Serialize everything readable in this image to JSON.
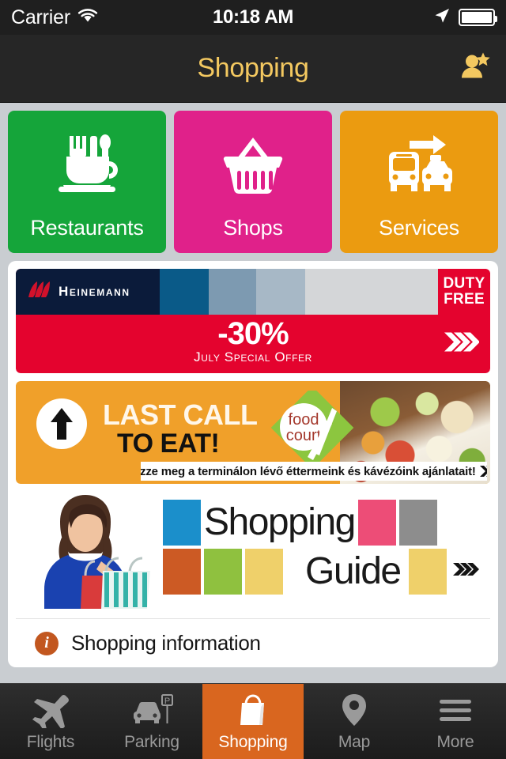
{
  "status_bar": {
    "carrier": "Carrier",
    "time": "10:18 AM",
    "wifi_icon": "wifi-icon",
    "location_icon": "location-arrow-icon",
    "battery_icon": "battery-full-icon"
  },
  "nav_bar": {
    "title": "Shopping",
    "title_color": "#f3c860",
    "right_icon": "person-star-icon"
  },
  "categories": [
    {
      "label": "Restaurants",
      "color": "#15a53a",
      "icon": "cup-cutlery-icon"
    },
    {
      "label": "Shops",
      "color": "#e0218a",
      "icon": "shopping-basket-icon"
    },
    {
      "label": "Services",
      "color": "#eb9b10",
      "icon": "bus-taxi-arrow-icon"
    }
  ],
  "promos": {
    "heinemann": {
      "brand": "Heinemann",
      "duty_free_line1": "DUTY",
      "duty_free_line2": "FREE",
      "discount": "-30%",
      "subtitle": "July Special Offer",
      "red": "#e4032e",
      "navy": "#0b1b3a",
      "chevron_icon": "chevron-triple-right-icon"
    },
    "food_court": {
      "headline_line1": "LAST CALL",
      "headline_line2": "TO EAT!",
      "logo_line1": "food",
      "logo_line2": "court",
      "caption": "Nézze meg a terminálon lévő éttermeink és  kávézóink ajánlatait!",
      "background": "#f0a02a",
      "arrow_icon": "arrow-up-circle-icon",
      "chevron_icon": "chevron-triple-right-icon"
    },
    "shopping_guide": {
      "word1": "Shopping",
      "word2": "Guide",
      "swatches_top": [
        "#1b8fcb",
        "#ed4d77",
        "#8d8d8d"
      ],
      "swatches_bottom": [
        "#cc5a24",
        "#8fc13f",
        "#efd06a",
        "#efd06a"
      ],
      "photo_alt": "woman-with-shopping-bags-photo",
      "chevron_icon": "chevron-triple-right-icon"
    }
  },
  "info_row": {
    "label": "Shopping information",
    "icon": "info-circle-icon",
    "icon_color": "#c2571f"
  },
  "tab_bar": {
    "active_color": "#d9661f",
    "items": [
      {
        "label": "Flights",
        "icon": "airplane-icon",
        "active": false
      },
      {
        "label": "Parking",
        "icon": "car-parking-icon",
        "active": false
      },
      {
        "label": "Shopping",
        "icon": "shopping-bag-icon",
        "active": true
      },
      {
        "label": "Map",
        "icon": "map-pin-icon",
        "active": false
      },
      {
        "label": "More",
        "icon": "hamburger-menu-icon",
        "active": false
      }
    ]
  }
}
